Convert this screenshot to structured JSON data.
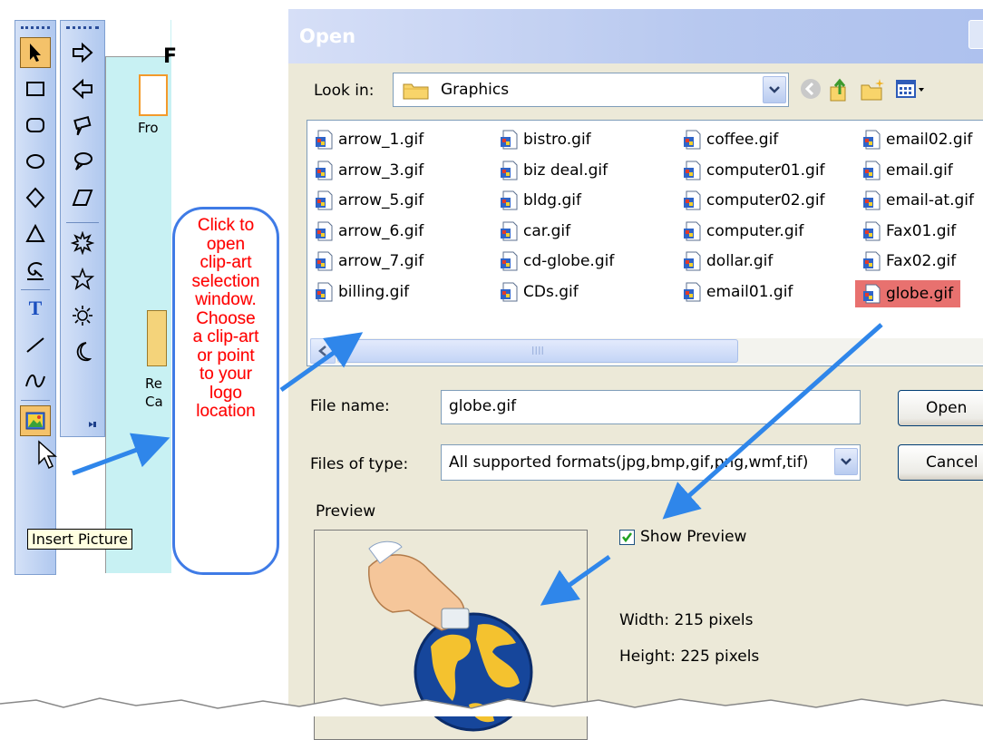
{
  "left_toolbar": {
    "tools_col1": [
      "pointer-icon",
      "rectangle-icon",
      "rounded-rectangle-icon",
      "ellipse-icon",
      "diamond-icon",
      "triangle-icon",
      "arc-icon",
      "text-tool-icon",
      "line-icon",
      "curve-icon",
      "insert-picture-icon"
    ],
    "tools_col2": [
      "right-arrow-icon",
      "left-arrow-icon",
      "speech-bubble-icon",
      "thought-bubble-icon",
      "parallelogram-icon",
      "burst-icon",
      "star-icon",
      "sun-icon",
      "moon-icon"
    ],
    "tooltip": "Insert Picture",
    "text_tool_glyph": "T"
  },
  "background": {
    "canvas_letter": "F",
    "label_1": "Fro",
    "label_2": "Re",
    "label_3": "Ca"
  },
  "callout": {
    "text": "Click to\nopen\nclip-art\nselection\nwindow.\nChoose\na clip-art\nor point\nto your\nlogo\nlocation",
    "color": "#ff0000",
    "border_color": "#3f7be6"
  },
  "dialog": {
    "title": "Open",
    "look_in_label": "Look in:",
    "look_in_value": "Graphics",
    "files": [
      [
        "arrow_1.gif",
        "arrow_3.gif",
        "arrow_5.gif",
        "arrow_6.gif",
        "arrow_7.gif",
        "billing.gif"
      ],
      [
        "bistro.gif",
        "biz deal.gif",
        "bldg.gif",
        "car.gif",
        "cd-globe.gif",
        "CDs.gif"
      ],
      [
        "coffee.gif",
        "computer01.gif",
        "computer02.gif",
        "computer.gif",
        "dollar.gif",
        "email01.gif"
      ],
      [
        "email02.gif",
        "email.gif",
        "email-at.gif",
        "Fax01.gif",
        "Fax02.gif",
        "globe.gif"
      ]
    ],
    "selected_file": "globe.gif",
    "highlight_color": "#e8716f",
    "scroll_grip": "IIII",
    "file_name_label": "File name:",
    "file_name_value": "globe.gif",
    "files_of_type_label": "Files of type:",
    "files_of_type_value": "All supported formats(jpg,bmp,gif,png,wmf,tif)",
    "open_button": "Open",
    "cancel_button": "Cancel",
    "preview_label": "Preview",
    "show_preview_label": "Show Preview",
    "show_preview_checked": true,
    "width_text": "Width: 215 pixels",
    "height_text": "Height: 225 pixels"
  },
  "arrow_color": "#2f86ea"
}
